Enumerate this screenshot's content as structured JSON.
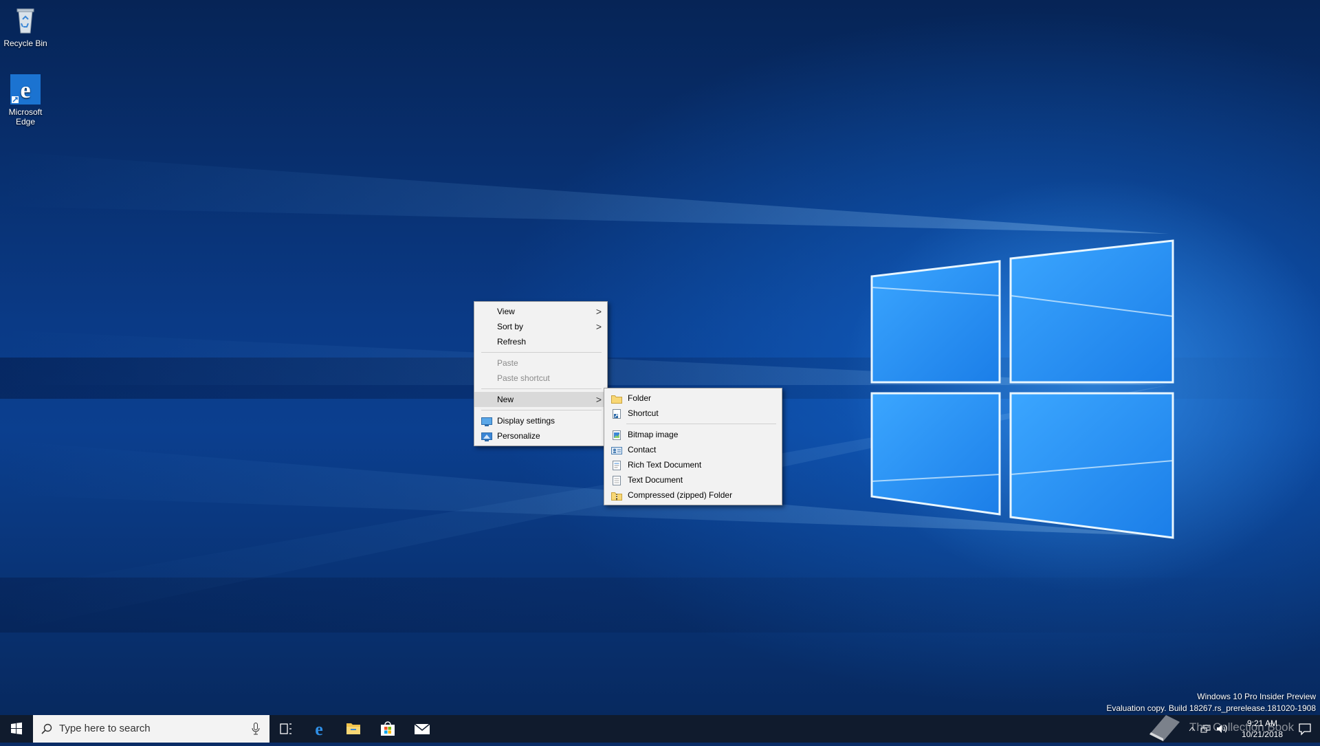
{
  "desktop": {
    "icons": [
      {
        "label": "Recycle Bin",
        "icon": "recycle-bin-icon"
      },
      {
        "label": "Microsoft Edge",
        "icon": "edge-icon"
      }
    ]
  },
  "context_menu": {
    "items": [
      {
        "label": "View",
        "has_submenu": true,
        "enabled": true
      },
      {
        "label": "Sort by",
        "has_submenu": true,
        "enabled": true
      },
      {
        "label": "Refresh",
        "enabled": true
      },
      {
        "label": "Paste",
        "enabled": false
      },
      {
        "label": "Paste shortcut",
        "enabled": false
      },
      {
        "label": "New",
        "has_submenu": true,
        "enabled": true,
        "highlighted": true
      },
      {
        "label": "Display settings",
        "icon": "display-icon",
        "enabled": true
      },
      {
        "label": "Personalize",
        "icon": "personalize-icon",
        "enabled": true
      }
    ],
    "arrow_glyph": ">"
  },
  "new_submenu": {
    "items": [
      {
        "label": "Folder",
        "icon": "folder-icon"
      },
      {
        "label": "Shortcut",
        "icon": "shortcut-icon"
      },
      {
        "label": "Bitmap image",
        "icon": "bitmap-icon"
      },
      {
        "label": "Contact",
        "icon": "contact-icon"
      },
      {
        "label": "Rich Text Document",
        "icon": "rtf-icon"
      },
      {
        "label": "Text Document",
        "icon": "text-document-icon"
      },
      {
        "label": "Compressed (zipped) Folder",
        "icon": "zip-folder-icon"
      }
    ]
  },
  "taskbar": {
    "search_placeholder": "Type here to search",
    "pinned": [
      "task-view",
      "edge",
      "file-explorer",
      "store",
      "mail"
    ],
    "clock": {
      "time": "9:21 AM",
      "date": "10/21/2018"
    }
  },
  "watermark": {
    "line1": "Windows 10 Pro Insider Preview",
    "line2": "Evaluation copy. Build 18267.rs_prerelease.181020-1908"
  },
  "overlay_text": "The Collection Book",
  "colors": {
    "taskbar": "#101b2d",
    "menu_bg": "#f2f2f2",
    "menu_highlight": "#d9d9d9",
    "accent": "#0078d7"
  }
}
